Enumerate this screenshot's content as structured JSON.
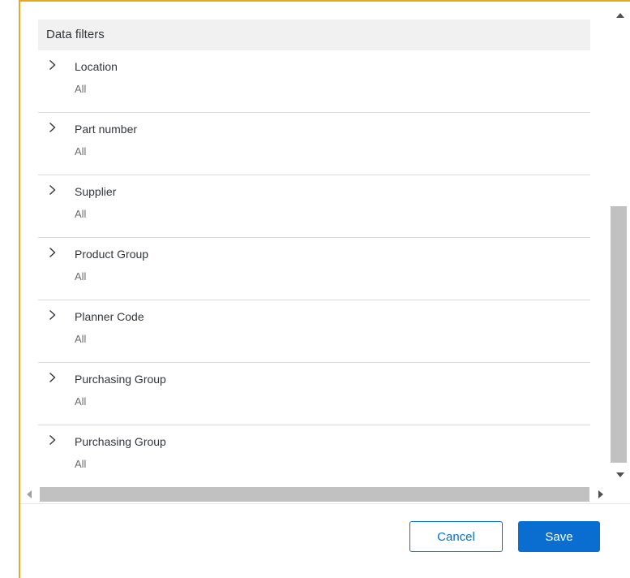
{
  "dialog": {
    "section_title": "Data filters",
    "filters": [
      {
        "label": "Location",
        "value": "All"
      },
      {
        "label": "Part number",
        "value": "All"
      },
      {
        "label": "Supplier",
        "value": "All"
      },
      {
        "label": "Product Group",
        "value": "All"
      },
      {
        "label": "Planner Code",
        "value": "All"
      },
      {
        "label": "Purchasing Group",
        "value": "All"
      },
      {
        "label": "Purchasing Group",
        "value": "All"
      }
    ],
    "icons": {
      "expand": "chevron-right-icon",
      "scroll_up": "triangle-up-icon",
      "scroll_down": "triangle-down-icon",
      "scroll_left": "triangle-left-icon",
      "scroll_right": "triangle-right-icon"
    }
  },
  "footer": {
    "cancel_label": "Cancel",
    "save_label": "Save"
  },
  "colors": {
    "accent": "#0a6ed1",
    "dialog_border": "#e5a823",
    "header_background": "#f1f1f1",
    "scrollbar_thumb": "#c1c1c1"
  }
}
